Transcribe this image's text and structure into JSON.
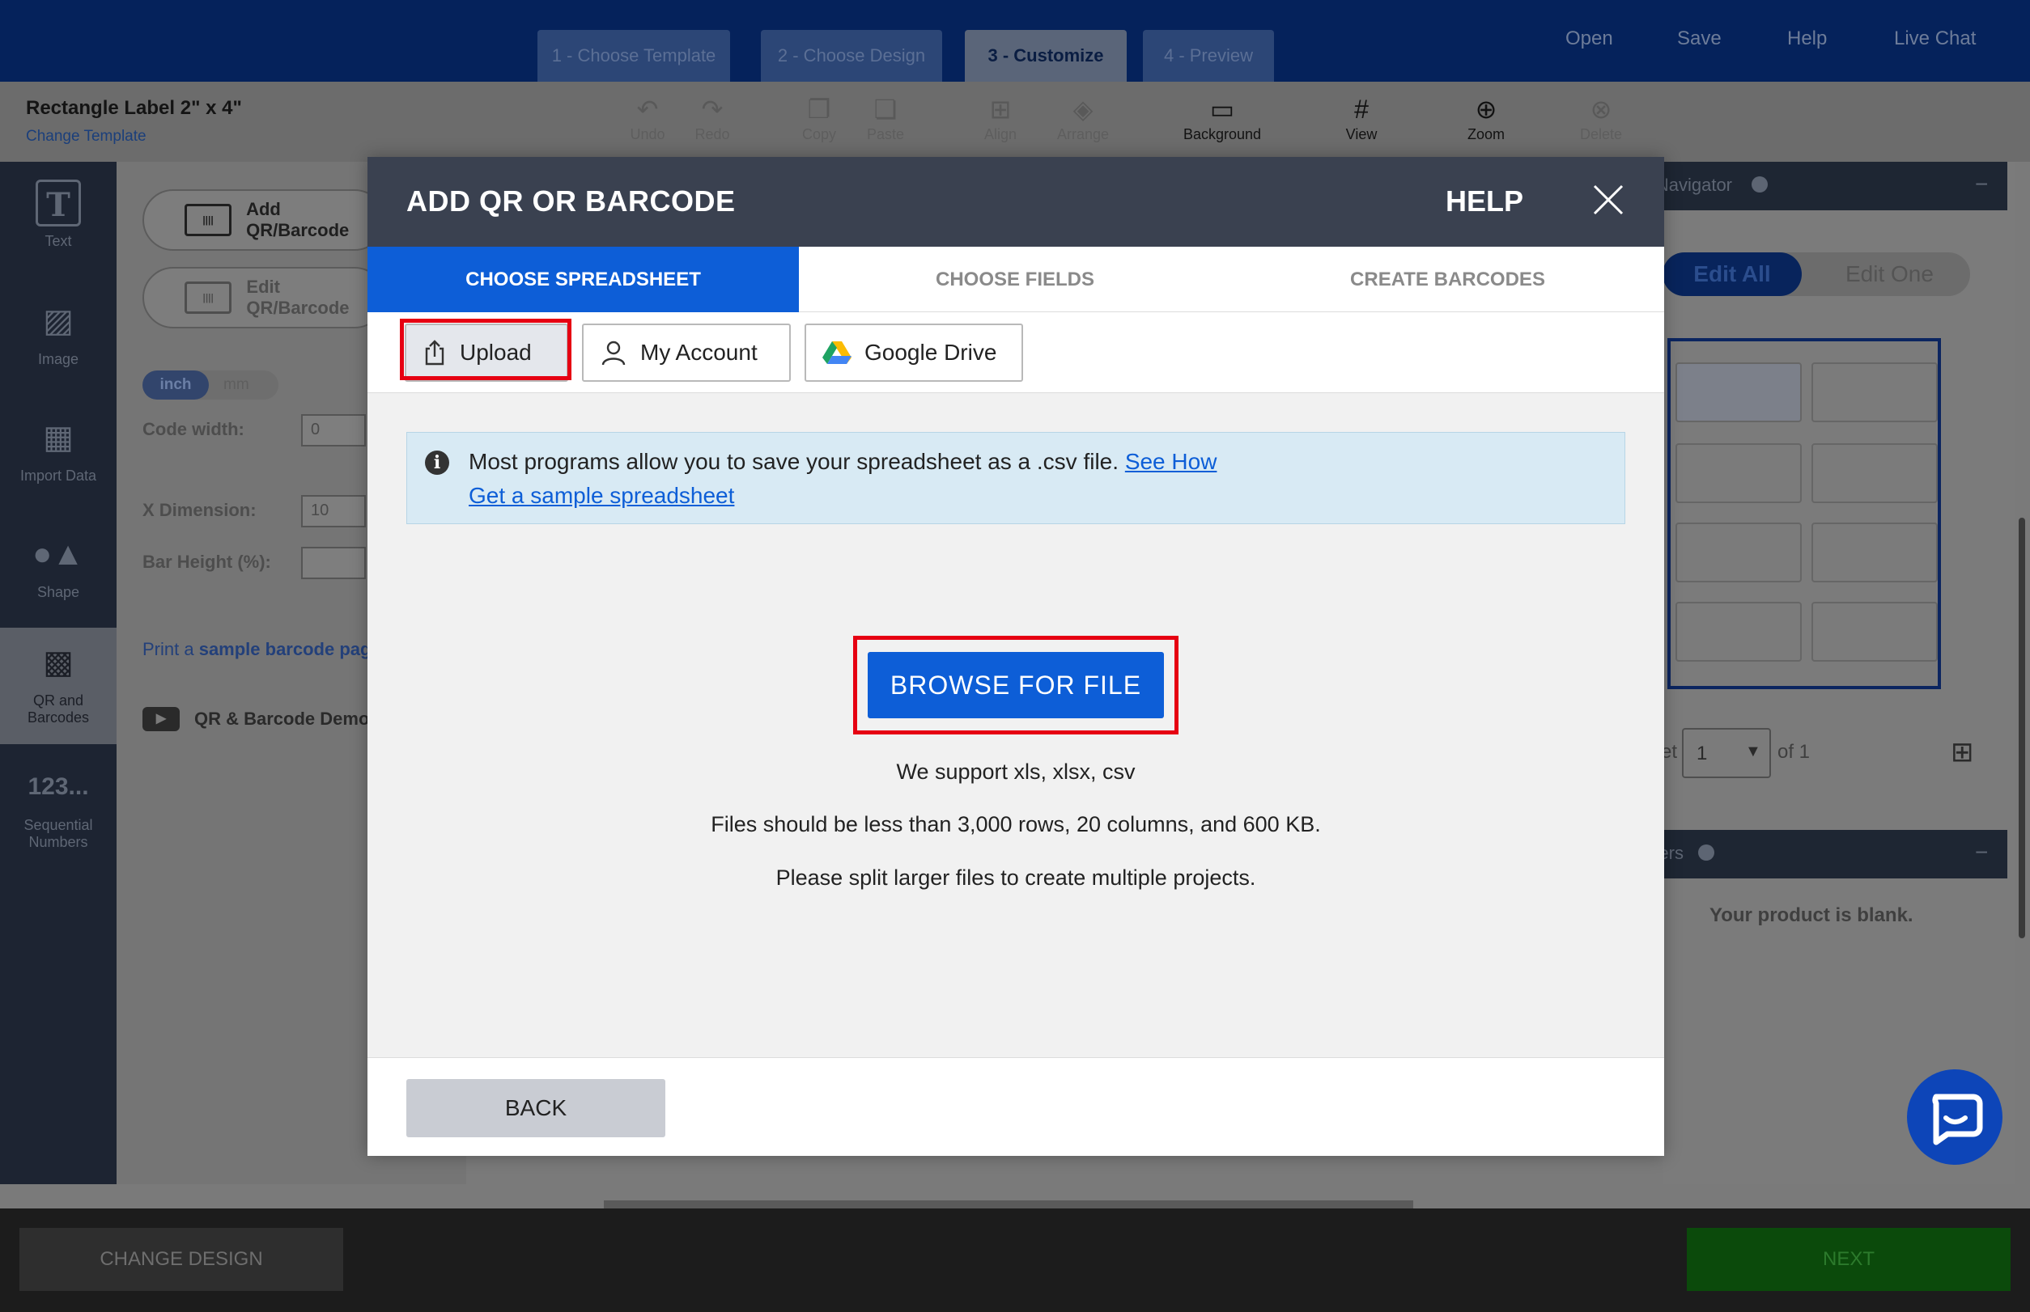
{
  "steps": [
    "1 - Choose Template",
    "2 - Choose Design",
    "3 - Customize",
    "4 - Preview"
  ],
  "topnav": {
    "open": "Open",
    "save": "Save",
    "help": "Help",
    "live_chat": "Live Chat"
  },
  "product": {
    "title": "Rectangle Label 2\" x 4\"",
    "change_template": "Change Template"
  },
  "toolbar": {
    "undo": "Undo",
    "redo": "Redo",
    "copy": "Copy",
    "paste": "Paste",
    "align": "Align",
    "arrange": "Arrange",
    "background": "Background",
    "view": "View",
    "zoom": "Zoom",
    "delete": "Delete"
  },
  "rail": {
    "text": "Text",
    "image": "Image",
    "import_data": "Import Data",
    "shape": "Shape",
    "qr_line1": "QR and",
    "qr_line2": "Barcodes",
    "seq_icon": "123...",
    "seq_line1": "Sequential",
    "seq_line2": "Numbers"
  },
  "leftpanel": {
    "add_qr": "Add QR/Barcode",
    "edit_qr": "Edit QR/Barcode",
    "unit_inch": "inch",
    "unit_mm": "mm",
    "code_width_label": "Code width:",
    "code_width_value": "0",
    "x_dimension_label": "X Dimension:",
    "x_dimension_value": "10",
    "bar_height_label": "Bar Height (%):",
    "print_sample_prefix": "Print a ",
    "print_sample_link": "sample barcode page",
    "demo_link": "QR & Barcode Demo"
  },
  "rightpanel": {
    "navigator_title": "Navigator",
    "edit_all": "Edit All",
    "edit_one": "Edit One",
    "sheet_label": "Sheet",
    "sheet_value": "1",
    "of_label": "of 1",
    "layers_title": "Layers",
    "blank_text": "Your product is blank."
  },
  "bottombar": {
    "change_design": "CHANGE DESIGN",
    "next": "NEXT"
  },
  "modal": {
    "title": "ADD QR OR BARCODE",
    "help": "HELP",
    "tabs": [
      "CHOOSE SPREADSHEET",
      "CHOOSE FIELDS",
      "CREATE BARCODES"
    ],
    "sources": {
      "upload": "Upload",
      "my_account": "My Account",
      "google_drive": "Google Drive"
    },
    "info_text": "Most programs allow you to save your spreadsheet as a .csv file.",
    "see_how": "See How",
    "sample_link": "Get a sample spreadsheet",
    "browse_button": "BROWSE FOR FILE",
    "support_line1": "We support xls, xlsx, csv",
    "support_line2": "Files should be less than 3,000 rows, 20 columns, and 600 KB.",
    "support_line3": "Please split larger files to create multiple projects.",
    "back_button": "BACK"
  },
  "colors": {
    "accent": "#0d5ed7",
    "header": "#3a4150",
    "highlight": "#e60012",
    "nav": "#05225b"
  }
}
